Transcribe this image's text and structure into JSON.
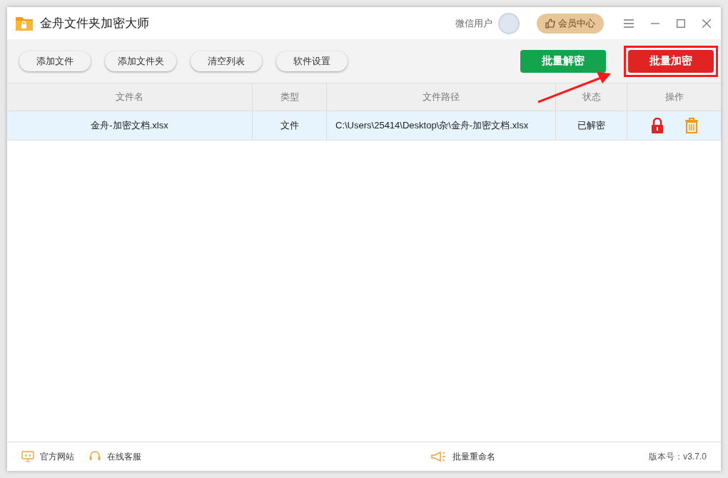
{
  "window": {
    "title": "金舟文件夹加密大师"
  },
  "user": {
    "name": "微信用户"
  },
  "vip_button": "会员中心",
  "toolbar": {
    "buttons": [
      "添加文件",
      "添加文件夹",
      "清空列表",
      "软件设置"
    ],
    "actions": [
      {
        "label": "批量解密",
        "kind": "decrypt",
        "highlighted": false
      },
      {
        "label": "批量加密",
        "kind": "encrypt",
        "highlighted": true
      }
    ]
  },
  "table": {
    "columns": [
      "文件名",
      "类型",
      "文件路径",
      "状态",
      "操作"
    ],
    "rows": [
      {
        "name": "金舟-加密文档.xlsx",
        "type": "文件",
        "path": "C:\\Users\\25414\\Desktop\\杂\\金舟-加密文档.xlsx",
        "status": "已解密",
        "selected": true
      }
    ]
  },
  "status_bar": {
    "links": [
      {
        "label": "官方网站",
        "kind": "website"
      },
      {
        "label": "在线客服",
        "kind": "support"
      }
    ],
    "center": "批量重命名",
    "version": "版本号：v3.7.0"
  }
}
